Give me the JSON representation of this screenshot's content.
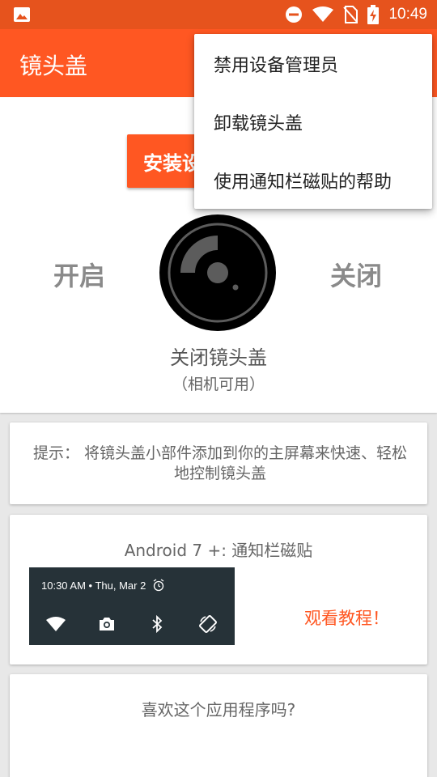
{
  "status_bar": {
    "time": "10:49",
    "icons": [
      "image-icon",
      "do-not-disturb-icon",
      "wifi-icon",
      "no-sim-icon",
      "battery-charging-icon"
    ]
  },
  "app_bar": {
    "title": "镜头盖"
  },
  "main": {
    "install_button": "安装设",
    "on_label": "开启",
    "off_label": "关闭",
    "state_title": "关闭镜头盖",
    "state_subtitle": "（相机可用）"
  },
  "tip_card": {
    "text": "提示： 将镜头盖小部件添加到你的主屏幕来快速、轻松地控制镜头盖"
  },
  "tile_card": {
    "title": "Android 7 +: 通知栏磁贴",
    "preview_time": "10:30 AM • Thu, Mar 2",
    "preview_icons": [
      "wifi-icon",
      "camera-icon",
      "bluetooth-icon",
      "rotate-icon"
    ],
    "watch_link": "观看教程！"
  },
  "rate_card": {
    "title": "喜欢这个应用程序吗?"
  },
  "overflow_menu": {
    "items": [
      "禁用设备管理员",
      "卸载镜头盖",
      "使用通知栏磁贴的帮助"
    ]
  },
  "colors": {
    "accent": "#ff5722",
    "status_bar": "#e6531d",
    "qs_panel": "#263238"
  }
}
